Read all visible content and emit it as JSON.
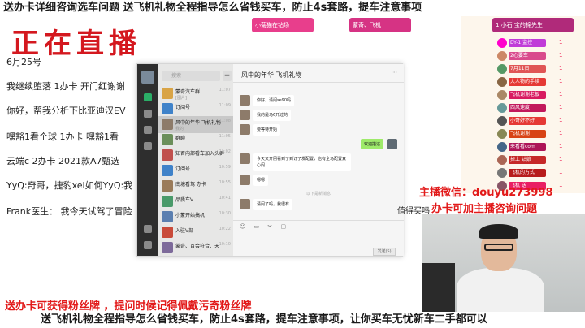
{
  "top_banner": "送办卡详细咨询选车问题 送飞机礼物全程指导怎么省钱买车，防止4s套路，提车注意事项",
  "notes": {
    "live_title": "正在直播",
    "date": "6月25号",
    "lines": [
      "我继续堕落 1办卡 开门红谢谢",
      "你好，帮我分析下比亚迪汉EV",
      "嘿豁1看个球  1办卡      嘿豁1看",
      "云端c 2办卡    2021款A7甄选",
      "YyQ:奇哥，捷豹xel如何YyQ:我",
      "Frank医生：  我今天试驾了冒险"
    ]
  },
  "wechat": {
    "search_placeholder": "搜索",
    "chat_title": "风中的年华 飞机礼物",
    "chats": [
      {
        "name": "蒙奇汽车群",
        "msg": "[图片]",
        "time": "11:07",
        "color": "#d9a446"
      },
      {
        "name": "订阅号",
        "msg": "",
        "time": "11:09",
        "color": "#3f82c9"
      },
      {
        "name": "风中的年华 飞机礼物",
        "msg": "我的",
        "time": "11:08",
        "color": "#8d7b6a"
      },
      {
        "name": "群聊",
        "msg": "",
        "time": "11:05",
        "color": "#6b8f5a"
      },
      {
        "name": "知否内部看车加入头群",
        "msg": "",
        "time": "11:02",
        "color": "#c0504d"
      },
      {
        "name": "订阅号",
        "msg": "",
        "time": "10:59",
        "color": "#3f82c9"
      },
      {
        "name": "南塘看驾 办卡",
        "msg": "",
        "time": "10:55",
        "color": "#9a7b5a"
      },
      {
        "name": "品质车V",
        "msg": "",
        "time": "10:41",
        "color": "#4a9a6a"
      },
      {
        "name": "小蒙开始搞机",
        "msg": "",
        "time": "10:30",
        "color": "#5b7fb0"
      },
      {
        "name": "入驻V部",
        "msg": "",
        "time": "10:22",
        "color": "#c94b3a"
      },
      {
        "name": "蒙奇、百会符合、天",
        "msg": "",
        "time": "10:10",
        "color": "#7d6a9a"
      }
    ],
    "messages": [
      {
        "side": "left",
        "text": "你好，请问se90吗"
      },
      {
        "side": "left",
        "text": "我的是马6开过的"
      },
      {
        "side": "left",
        "text": "要等待开始"
      },
      {
        "side": "right",
        "text": "欢迎描述"
      },
      {
        "side": "left",
        "text": "今天又开朋看到了到订了发配置，也有全马配置真心闷"
      },
      {
        "side": "left",
        "text": "嗯嗯"
      },
      {
        "side": "left",
        "text": "请问了吗，我很有"
      }
    ],
    "system_note": "以下是新消息",
    "tools": "☺ ▭ ✂ ▢",
    "send_label": "发送(S)"
  },
  "right_panel": {
    "stickers": [
      {
        "text": "小菊猫在钻场",
        "color": "#e83e8c"
      },
      {
        "text": "蒙奇、飞机",
        "color": "#d63384"
      },
      {
        "text": "1 小石 宝的棉先生",
        "color": "#b02a7a"
      }
    ],
    "gifts": [
      {
        "tag": "DY-1 监控",
        "count": "1",
        "color": "#c03bd8",
        "av": "#f0c"
      },
      {
        "tag": "2心要车",
        "count": "1",
        "color": "#d94b8c",
        "av": "#c86"
      },
      {
        "tag": "7月11日",
        "count": "1",
        "color": "#e05555",
        "av": "#596"
      },
      {
        "tag": "大人物的手续",
        "count": "1",
        "color": "#e53935",
        "av": "#864"
      },
      {
        "tag": "飞机谢谢老板",
        "count": "1",
        "color": "#d81b60",
        "av": "#a86"
      },
      {
        "tag": "西风速度",
        "count": "1",
        "color": "#c2185b",
        "av": "#699"
      },
      {
        "tag": "小哥好不好",
        "count": "1",
        "color": "#e53935",
        "av": "#555"
      },
      {
        "tag": "飞机谢谢",
        "count": "1",
        "color": "#d84315",
        "av": "#885"
      },
      {
        "tag": "来看看com",
        "count": "1",
        "color": "#ad1457",
        "av": "#468"
      },
      {
        "tag": "掉上 姑娘",
        "count": "1",
        "color": "#c62828",
        "av": "#a65"
      },
      {
        "tag": "飞机的方式",
        "count": "1",
        "color": "#b71c1c",
        "av": "#777"
      },
      {
        "tag": "飞机 送 ",
        "count": "1",
        "color": "#e91e63",
        "av": "#856"
      }
    ]
  },
  "overlay": {
    "contact_line1": "主播微信：douyu273998",
    "contact_line2": "办卡可加主播咨询问题",
    "side_text": "值得买吗",
    "bottom_red": "送办卡可获得粉丝牌 ，提问时候记得佩戴污奇粉丝牌",
    "bottom_banner": "送飞机礼物全程指导怎么省钱买车，防止4s套路，提车注意事项，让你买车无忧新车二手都可以"
  }
}
